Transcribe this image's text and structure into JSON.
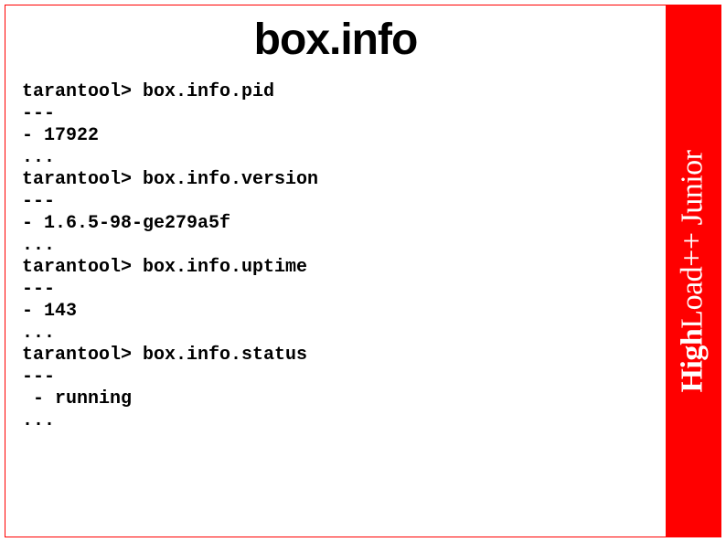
{
  "title": "box.info",
  "sidebar": {
    "bold_part": "High",
    "light_part": "Load++ Junior"
  },
  "terminal": {
    "prompt": "tarantool> ",
    "sep": "---",
    "ellipsis": "...",
    "blocks": [
      {
        "command": "box.info.pid",
        "result": "- 17922"
      },
      {
        "command": "box.info.version",
        "result": "- 1.6.5-98-ge279a5f"
      },
      {
        "command": "box.info.uptime",
        "result": "- 143"
      },
      {
        "command": "box.info.status",
        "result": " - running"
      }
    ]
  }
}
